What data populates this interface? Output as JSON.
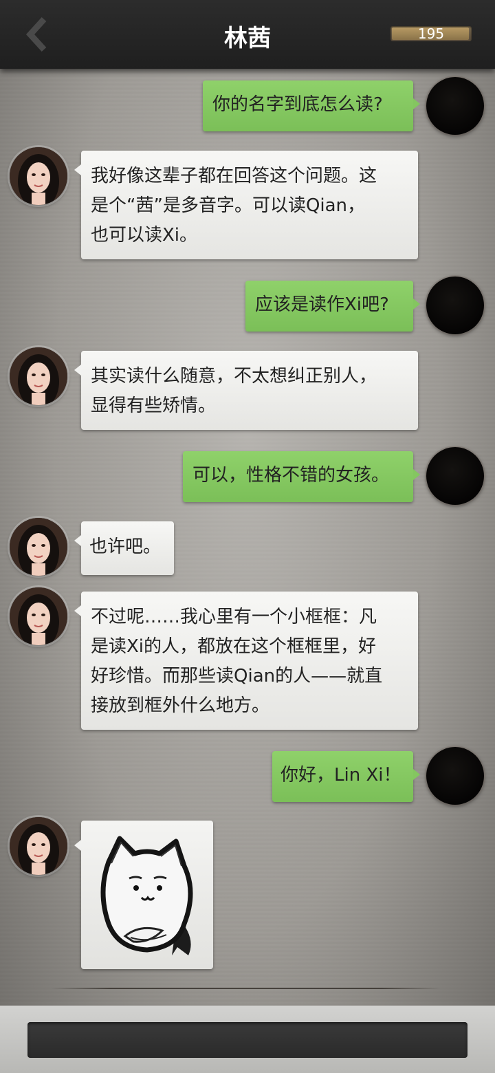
{
  "header": {
    "title": "林茜",
    "counter": "195",
    "counter_level": 0.95
  },
  "messages": [
    {
      "side": "right",
      "text": "你的名字到底怎么读?"
    },
    {
      "side": "left",
      "lines": [
        "我好像这辈子都在回答这个问题。这",
        "是个“茜”是多音字。可以读Qian，",
        "也可以读Xi。"
      ]
    },
    {
      "side": "right",
      "text": "应该是读作Xi吧?"
    },
    {
      "side": "left",
      "lines": [
        "其实读什么随意，不太想纠正别人，",
        "显得有些矫情。"
      ]
    },
    {
      "side": "right",
      "text": "可以，性格不错的女孩。"
    },
    {
      "side": "left",
      "lines": [
        "也许吧。"
      ]
    },
    {
      "side": "left",
      "lines": [
        "不过呢……我心里有一个小框框：凡",
        "是读Xi的人，都放在这个框框里，好",
        "好珍惜。而那些读Qian的人——就直",
        "接放到框外什么地方。"
      ]
    },
    {
      "side": "right",
      "text": "你好，Lin Xi！"
    },
    {
      "side": "left",
      "sticker": "cat-sticker"
    }
  ],
  "colors": {
    "header_bg": "#252525",
    "bubble_green": "#84c660",
    "bubble_white": "#f0f0ee"
  }
}
